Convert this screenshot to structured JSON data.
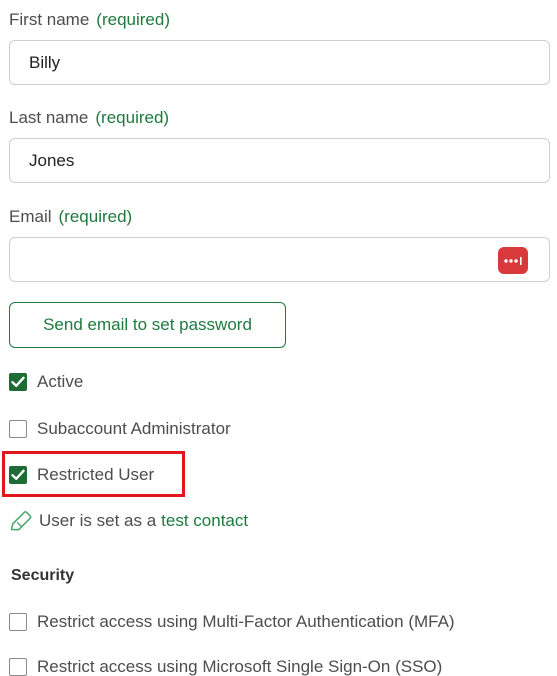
{
  "form": {
    "required_text": "(required)",
    "first_name": {
      "label": "First name",
      "value": "Billy"
    },
    "last_name": {
      "label": "Last name",
      "value": "Jones"
    },
    "email": {
      "label": "Email",
      "value": "",
      "password_manager_icon": "password-dots-icon"
    },
    "send_email_button": "Send email to set password",
    "checkboxes": {
      "active": {
        "label": "Active",
        "checked": true
      },
      "subaccount_admin": {
        "label": "Subaccount Administrator",
        "checked": false
      },
      "restricted_user": {
        "label": "Restricted User",
        "checked": true
      }
    },
    "test_contact": {
      "icon": "tag-icon",
      "text": "User is set as a",
      "link": "test contact"
    }
  },
  "security": {
    "title": "Security",
    "mfa": {
      "label": "Restrict access using Multi-Factor Authentication (MFA)",
      "checked": false
    },
    "sso": {
      "label": "Restrict access using Microsoft Single Sign-On (SSO)",
      "checked": false
    }
  },
  "colors": {
    "accent_green": "#1e7a3e",
    "checkbox_green": "#1e6b36",
    "highlight_red": "#e3161f",
    "password_icon_red": "#d8393a"
  }
}
